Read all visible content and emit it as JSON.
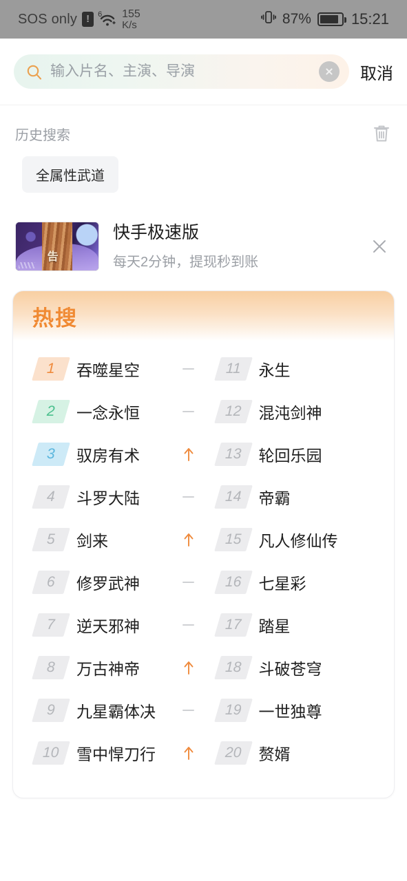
{
  "status_bar": {
    "carrier": "SOS only",
    "warning_icon": "!",
    "wifi_sup": "6",
    "net_speed_value": "155",
    "net_speed_unit": "K/s",
    "vibrate_icon": "vibrate-icon",
    "battery_percent": "87%",
    "clock": "15:21"
  },
  "search": {
    "placeholder": "输入片名、主演、导演",
    "value": "",
    "cancel_label": "取消"
  },
  "history": {
    "title": "历史搜索",
    "clear_icon": "trash-icon",
    "tags": [
      "全属性武道"
    ]
  },
  "ad": {
    "title": "快手极速版",
    "subtitle": "每天2分钟，提现秒到账",
    "thumb_badge": "告",
    "close_icon": "close-icon"
  },
  "hot": {
    "title": "热搜",
    "colors": {
      "accent_orange": "#ef8a3c",
      "rank1": "#ef8a3c",
      "rank2": "#4cc08e",
      "rank3": "#5ab6dd",
      "rank_default": "#b4b6ba"
    },
    "left": [
      {
        "rank": "1",
        "name": "吞噬星空",
        "trend": "flat"
      },
      {
        "rank": "2",
        "name": "一念永恒",
        "trend": "flat"
      },
      {
        "rank": "3",
        "name": "驭房有术",
        "trend": "up"
      },
      {
        "rank": "4",
        "name": "斗罗大陆",
        "trend": "flat"
      },
      {
        "rank": "5",
        "name": "剑来",
        "trend": "up"
      },
      {
        "rank": "6",
        "name": "修罗武神",
        "trend": "flat"
      },
      {
        "rank": "7",
        "name": "逆天邪神",
        "trend": "flat"
      },
      {
        "rank": "8",
        "name": "万古神帝",
        "trend": "up"
      },
      {
        "rank": "9",
        "name": "九星霸体决",
        "trend": "flat"
      },
      {
        "rank": "10",
        "name": "雪中悍刀行",
        "trend": "up"
      }
    ],
    "right": [
      {
        "rank": "11",
        "name": "永生",
        "trend": "none"
      },
      {
        "rank": "12",
        "name": "混沌剑神",
        "trend": "none"
      },
      {
        "rank": "13",
        "name": "轮回乐园",
        "trend": "none"
      },
      {
        "rank": "14",
        "name": "帝霸",
        "trend": "none"
      },
      {
        "rank": "15",
        "name": "凡人修仙传",
        "trend": "none"
      },
      {
        "rank": "16",
        "name": "七星彩",
        "trend": "none"
      },
      {
        "rank": "17",
        "name": "踏星",
        "trend": "none"
      },
      {
        "rank": "18",
        "name": "斗破苍穹",
        "trend": "none"
      },
      {
        "rank": "19",
        "name": "一世独尊",
        "trend": "none"
      },
      {
        "rank": "20",
        "name": "赘婿",
        "trend": "none"
      }
    ]
  }
}
